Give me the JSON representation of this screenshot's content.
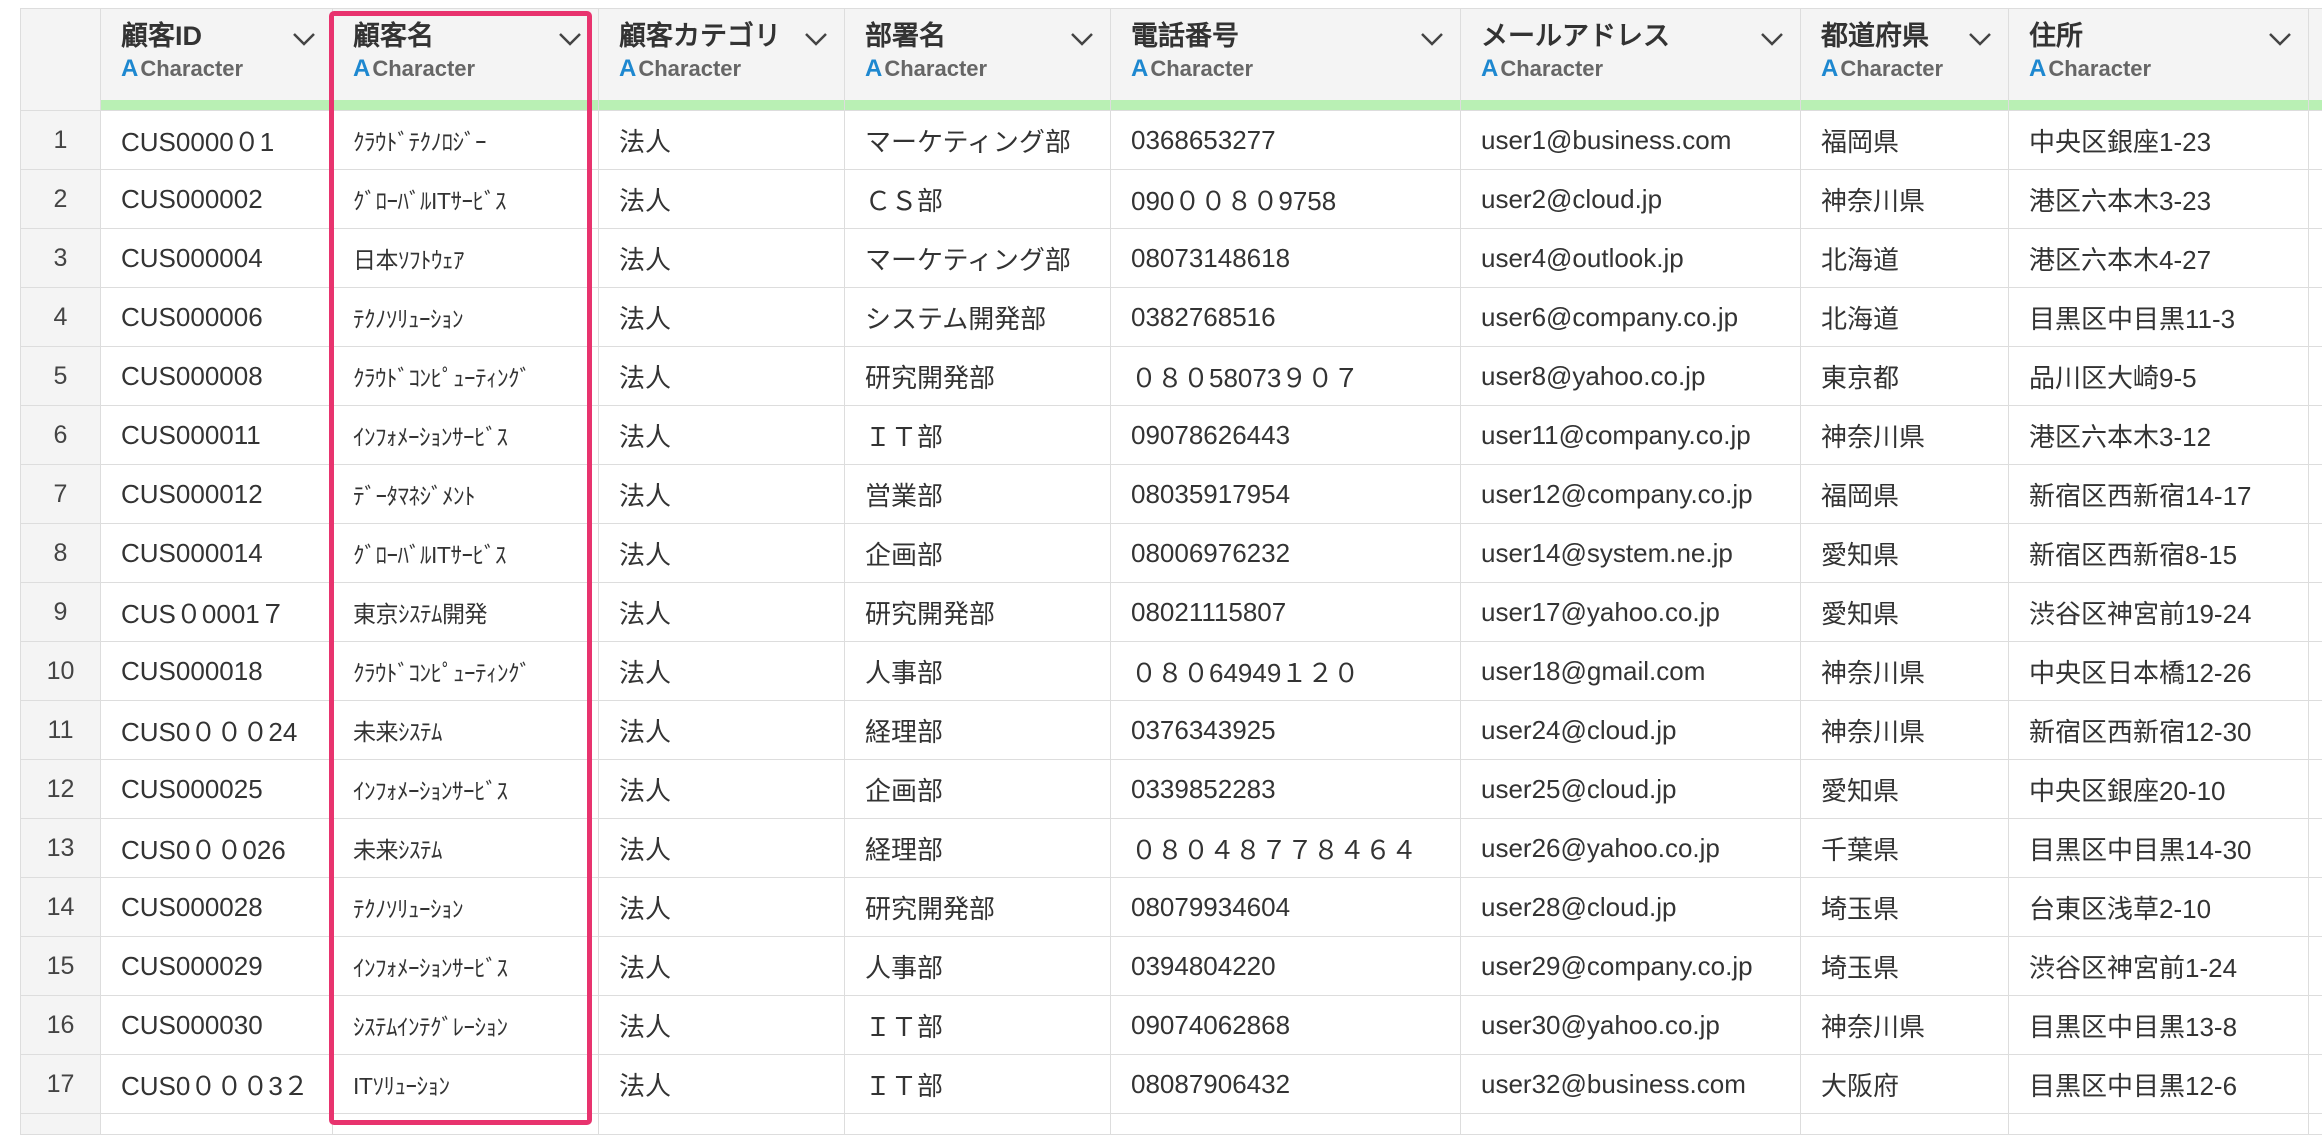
{
  "columns": [
    {
      "title": "顧客ID",
      "type": "Character"
    },
    {
      "title": "顧客名",
      "type": "Character"
    },
    {
      "title": "顧客カテゴリ",
      "type": "Character"
    },
    {
      "title": "部署名",
      "type": "Character"
    },
    {
      "title": "電話番号",
      "type": "Character"
    },
    {
      "title": "メールアドレス",
      "type": "Character"
    },
    {
      "title": "都道府県",
      "type": "Character"
    },
    {
      "title": "住所",
      "type": "Character"
    }
  ],
  "type_icon": "A",
  "colors": {
    "accent_highlight": "#e8336e",
    "type_icon": "#1e88d0",
    "header_bar": "#b9f0b4"
  },
  "rows": [
    {
      "n": "1",
      "id": "CUS0000０1",
      "name": "ｸﾗｳﾄﾞﾃｸﾉﾛｼﾞｰ",
      "cat": "法人",
      "dept": "マーケティング部",
      "phone": "0368653277",
      "email": "user1@business.com",
      "pref": "福岡県",
      "addr": "中央区銀座1-23"
    },
    {
      "n": "2",
      "id": "CUS000002",
      "name": "ｸﾞﾛｰﾊﾞﾙITｻｰﾋﾞｽ",
      "cat": "法人",
      "dept": "ＣＳ部",
      "phone": "090００８０9758",
      "email": "user2@cloud.jp",
      "pref": "神奈川県",
      "addr": "港区六本木3-23"
    },
    {
      "n": "3",
      "id": "CUS000004",
      "name": "日本ｿﾌﾄｳｪｱ",
      "cat": "法人",
      "dept": "マーケティング部",
      "phone": "08073148618",
      "email": "user4@outlook.jp",
      "pref": "北海道",
      "addr": "港区六本木4-27"
    },
    {
      "n": "4",
      "id": "CUS000006",
      "name": "ﾃｸﾉｿﾘｭｰｼｮﾝ",
      "cat": "法人",
      "dept": "システム開発部",
      "phone": "0382768516",
      "email": "user6@company.co.jp",
      "pref": "北海道",
      "addr": "目黒区中目黒11-3"
    },
    {
      "n": "5",
      "id": "CUS000008",
      "name": "ｸﾗｳﾄﾞｺﾝﾋﾟｭｰﾃｨﾝｸﾞ",
      "cat": "法人",
      "dept": "研究開発部",
      "phone": "０８０58073９０７",
      "email": "user8@yahoo.co.jp",
      "pref": "東京都",
      "addr": "品川区大崎9-5"
    },
    {
      "n": "6",
      "id": "CUS000011",
      "name": "ｲﾝﾌｫﾒｰｼｮﾝｻｰﾋﾞｽ",
      "cat": "法人",
      "dept": "ＩＴ部",
      "phone": "09078626443",
      "email": "user11@company.co.jp",
      "pref": "神奈川県",
      "addr": "港区六本木3-12"
    },
    {
      "n": "7",
      "id": "CUS000012",
      "name": "ﾃﾞｰﾀﾏﾈｼﾞﾒﾝﾄ",
      "cat": "法人",
      "dept": "営業部",
      "phone": "08035917954",
      "email": "user12@company.co.jp",
      "pref": "福岡県",
      "addr": "新宿区西新宿14-17"
    },
    {
      "n": "8",
      "id": "CUS000014",
      "name": "ｸﾞﾛｰﾊﾞﾙITｻｰﾋﾞｽ",
      "cat": "法人",
      "dept": "企画部",
      "phone": "08006976232",
      "email": "user14@system.ne.jp",
      "pref": "愛知県",
      "addr": "新宿区西新宿8-15"
    },
    {
      "n": "9",
      "id": "CUS０0001７",
      "name": "東京ｼｽﾃﾑ開発",
      "cat": "法人",
      "dept": "研究開発部",
      "phone": "08021115807",
      "email": "user17@yahoo.co.jp",
      "pref": "愛知県",
      "addr": "渋谷区神宮前19-24"
    },
    {
      "n": "10",
      "id": "CUS000018",
      "name": "ｸﾗｳﾄﾞｺﾝﾋﾟｭｰﾃｨﾝｸﾞ",
      "cat": "法人",
      "dept": "人事部",
      "phone": "０８０64949１２０",
      "email": "user18@gmail.com",
      "pref": "神奈川県",
      "addr": "中央区日本橋12-26"
    },
    {
      "n": "11",
      "id": "CUS0０００24",
      "name": "未来ｼｽﾃﾑ",
      "cat": "法人",
      "dept": "経理部",
      "phone": "0376343925",
      "email": "user24@cloud.jp",
      "pref": "神奈川県",
      "addr": "新宿区西新宿12-30"
    },
    {
      "n": "12",
      "id": "CUS000025",
      "name": "ｲﾝﾌｫﾒｰｼｮﾝｻｰﾋﾞｽ",
      "cat": "法人",
      "dept": "企画部",
      "phone": "0339852283",
      "email": "user25@cloud.jp",
      "pref": "愛知県",
      "addr": "中央区銀座20-10"
    },
    {
      "n": "13",
      "id": "CUS0００026",
      "name": "未来ｼｽﾃﾑ",
      "cat": "法人",
      "dept": "経理部",
      "phone": "０８０４８７７８４６４",
      "email": "user26@yahoo.co.jp",
      "pref": "千葉県",
      "addr": "目黒区中目黒14-30"
    },
    {
      "n": "14",
      "id": "CUS000028",
      "name": "ﾃｸﾉｿﾘｭｰｼｮﾝ",
      "cat": "法人",
      "dept": "研究開発部",
      "phone": "08079934604",
      "email": "user28@cloud.jp",
      "pref": "埼玉県",
      "addr": "台東区浅草2-10"
    },
    {
      "n": "15",
      "id": "CUS000029",
      "name": "ｲﾝﾌｫﾒｰｼｮﾝｻｰﾋﾞｽ",
      "cat": "法人",
      "dept": "人事部",
      "phone": "0394804220",
      "email": "user29@company.co.jp",
      "pref": "埼玉県",
      "addr": "渋谷区神宮前1-24"
    },
    {
      "n": "16",
      "id": "CUS000030",
      "name": "ｼｽﾃﾑｲﾝﾃｸﾞﾚｰｼｮﾝ",
      "cat": "法人",
      "dept": "ＩＴ部",
      "phone": "09074062868",
      "email": "user30@yahoo.co.jp",
      "pref": "神奈川県",
      "addr": "目黒区中目黒13-8"
    },
    {
      "n": "17",
      "id": "CUS0０００3２",
      "name": "ITｿﾘｭｰｼｮﾝ",
      "cat": "法人",
      "dept": "ＩＴ部",
      "phone": "08087906432",
      "email": "user32@business.com",
      "pref": "大阪府",
      "addr": "目黒区中目黒12-6"
    }
  ]
}
